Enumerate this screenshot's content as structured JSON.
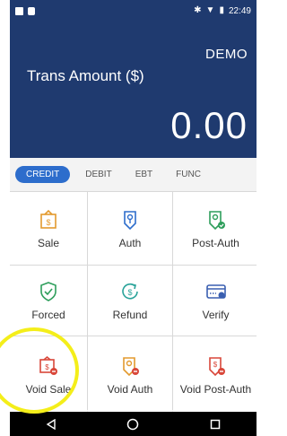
{
  "status_bar": {
    "left_icons": [
      "image-icon",
      "notification-icon"
    ],
    "right_icons": [
      "bluetooth-icon",
      "wifi-icon",
      "battery-icon"
    ],
    "time": "22:49"
  },
  "header": {
    "mode": "DEMO",
    "amount_label": "Trans Amount ($)",
    "amount": "0.00"
  },
  "tabs": [
    {
      "label": "CREDIT",
      "active": true
    },
    {
      "label": "DEBIT",
      "active": false
    },
    {
      "label": "EBT",
      "active": false
    },
    {
      "label": "FUNC",
      "active": false
    }
  ],
  "actions": [
    {
      "label": "Sale",
      "icon": "sale-icon",
      "color": "#e39a2e"
    },
    {
      "label": "Auth",
      "icon": "auth-icon",
      "color": "#2d6dcc"
    },
    {
      "label": "Post-Auth",
      "icon": "post-auth-icon",
      "color": "#2e9e5b"
    },
    {
      "label": "Forced",
      "icon": "forced-icon",
      "color": "#2e9e5b"
    },
    {
      "label": "Refund",
      "icon": "refund-icon",
      "color": "#2aa39a"
    },
    {
      "label": "Verify",
      "icon": "verify-icon",
      "color": "#3a5fb0"
    },
    {
      "label": "Void Sale",
      "icon": "void-sale-icon",
      "color": "#d9473a"
    },
    {
      "label": "Void Auth",
      "icon": "void-auth-icon",
      "color": "#e39a2e"
    },
    {
      "label": "Void Post-Auth",
      "icon": "void-post-auth-icon",
      "color": "#d9473a"
    }
  ],
  "nav": [
    "back-icon",
    "home-icon",
    "recents-icon"
  ],
  "colors": {
    "header_bg": "#1f3a6f",
    "accent": "#2d6dcc",
    "highlight": "#f4ee1a"
  }
}
